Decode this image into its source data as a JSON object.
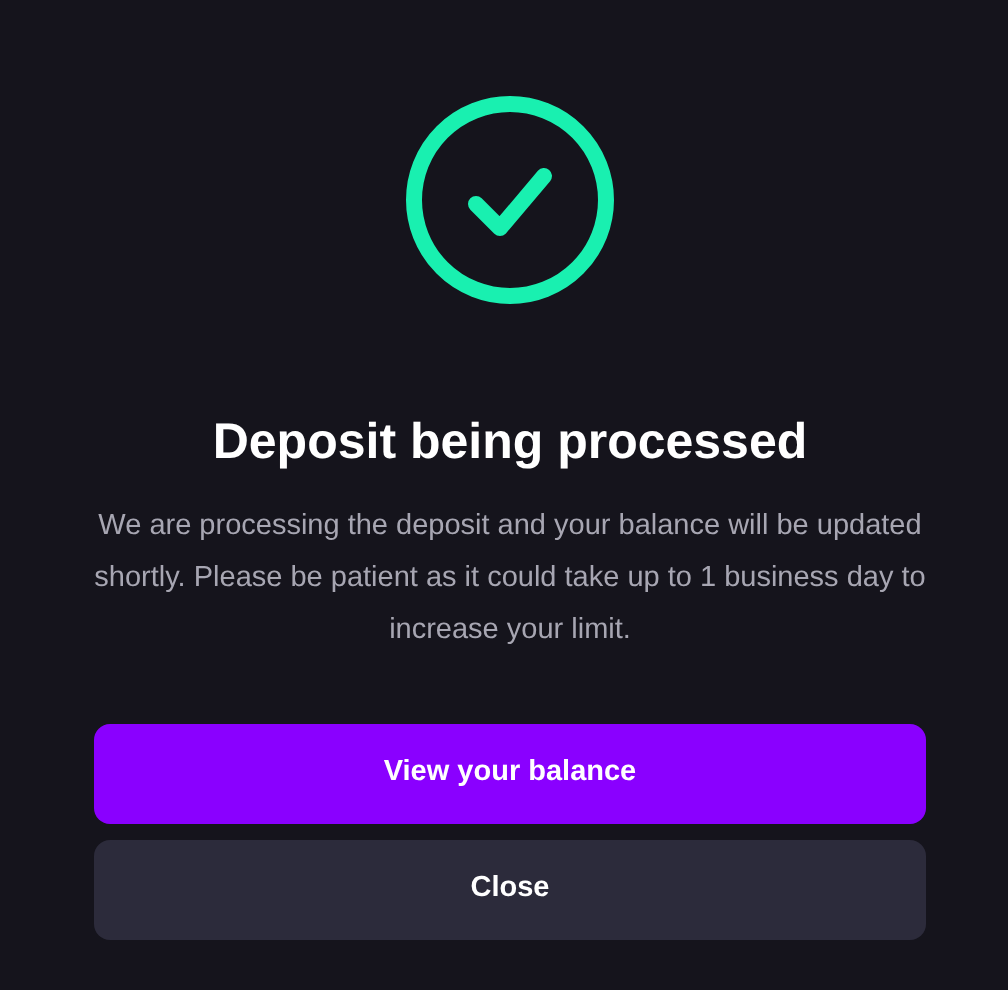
{
  "dialog": {
    "title": "Deposit being processed",
    "message": "We are processing the deposit and your balance will be updated shortly. Please be patient as it could take up to 1 business day to increase your limit.",
    "buttons": [
      {
        "label": "View your balance",
        "kind": "primary"
      },
      {
        "label": "Close",
        "kind": "secondary"
      }
    ]
  }
}
